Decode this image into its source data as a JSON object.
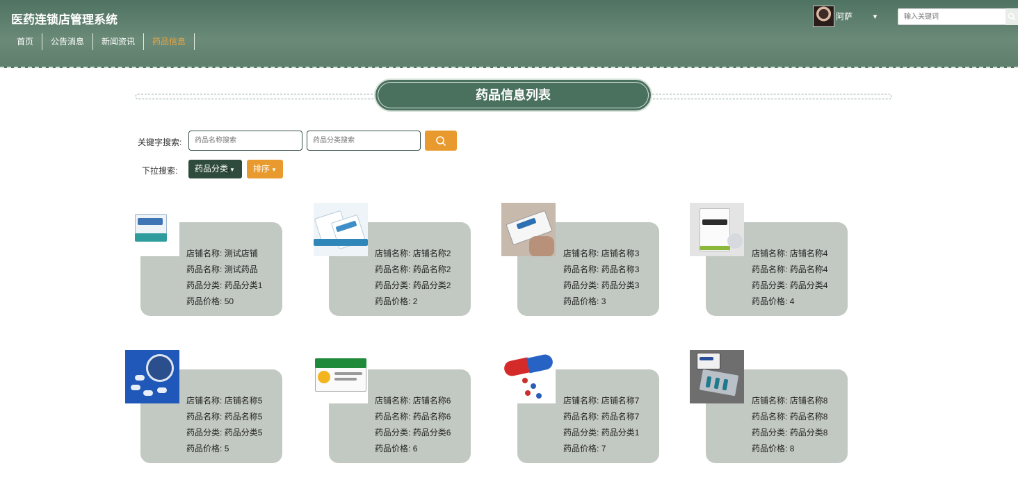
{
  "header": {
    "app_title": "医药连锁店管理系统",
    "nav": [
      {
        "label": "首页",
        "active": false
      },
      {
        "label": "公告消息",
        "active": false
      },
      {
        "label": "新闻资讯",
        "active": false
      },
      {
        "label": "药品信息",
        "active": true
      }
    ],
    "user_name": "阿萨",
    "search_placeholder": "输入关键词"
  },
  "section_title": "药品信息列表",
  "search": {
    "keyword_label": "关键字搜索:",
    "name_placeholder": "药品名称搜索",
    "category_placeholder": "药品分类搜索",
    "dropdown_label": "下拉搜索:",
    "category_button": "药品分类",
    "sort_button": "排序"
  },
  "field_labels": {
    "shop": "店铺名称:",
    "name": "药品名称:",
    "category": "药品分类:",
    "price": "药品价格:"
  },
  "products": [
    {
      "shop": "测试店铺",
      "name": "测试药品",
      "category": "药品分类1",
      "price": "50"
    },
    {
      "shop": "店铺名称2",
      "name": "药品名称2",
      "category": "药品分类2",
      "price": "2"
    },
    {
      "shop": "店铺名称3",
      "name": "药品名称3",
      "category": "药品分类3",
      "price": "3"
    },
    {
      "shop": "店铺名称4",
      "name": "药品名称4",
      "category": "药品分类4",
      "price": "4"
    },
    {
      "shop": "店铺名称5",
      "name": "药品名称5",
      "category": "药品分类5",
      "price": "5"
    },
    {
      "shop": "店铺名称6",
      "name": "药品名称6",
      "category": "药品分类6",
      "price": "6"
    },
    {
      "shop": "店铺名称7",
      "name": "药品名称7",
      "category": "药品分类1",
      "price": "7"
    },
    {
      "shop": "店铺名称8",
      "name": "药品名称8",
      "category": "药品分类8",
      "price": "8"
    }
  ],
  "colors": {
    "header_green": "#5e7f6c",
    "accent_orange": "#e99a2e",
    "dark_green": "#2f4b3d",
    "card_bg": "#c2c9c2"
  }
}
